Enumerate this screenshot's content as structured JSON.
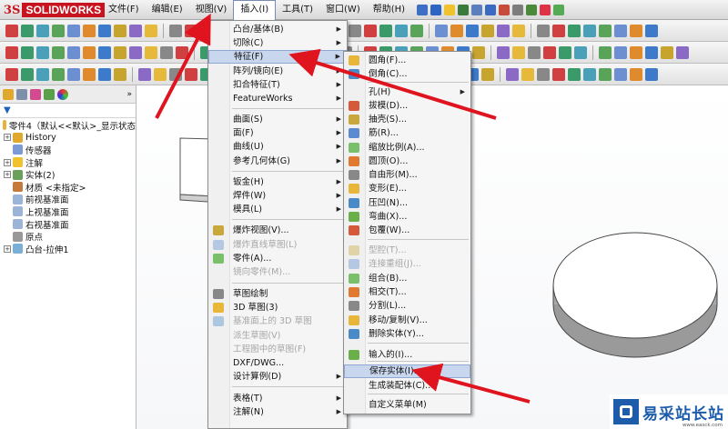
{
  "app": {
    "logo_ds": "3S",
    "logo_text": "SOLIDWORKS"
  },
  "menubar": [
    {
      "label": "文件(F)"
    },
    {
      "label": "编辑(E)"
    },
    {
      "label": "视图(V)"
    },
    {
      "label": "插入(I)",
      "active": true
    },
    {
      "label": "工具(T)"
    },
    {
      "label": "窗口(W)"
    },
    {
      "label": "帮助(H)"
    }
  ],
  "feature_tree": {
    "root": "零件4（默认<<默认>_显示状态",
    "items": [
      {
        "label": "History",
        "expandable": true
      },
      {
        "label": "传感器",
        "expandable": false
      },
      {
        "label": "注解",
        "expandable": true
      },
      {
        "label": "实体(2)",
        "expandable": true
      },
      {
        "label": "材质 <未指定>",
        "expandable": false
      },
      {
        "label": "前视基准面",
        "expandable": false
      },
      {
        "label": "上视基准面",
        "expandable": false
      },
      {
        "label": "右视基准面",
        "expandable": false
      },
      {
        "label": "原点",
        "expandable": false
      },
      {
        "label": "凸台-拉伸1",
        "expandable": true
      }
    ]
  },
  "insert_menu": [
    {
      "label": "凸台/基体(B)",
      "submenu": true
    },
    {
      "label": "切除(C)",
      "submenu": true
    },
    {
      "label": "特征(F)",
      "submenu": true,
      "highlighted": true
    },
    {
      "label": "阵列/镜向(E)",
      "submenu": true
    },
    {
      "label": "扣合特征(T)",
      "submenu": true
    },
    {
      "label": "FeatureWorks",
      "submenu": true
    },
    {
      "label": "曲面(S)",
      "submenu": true
    },
    {
      "label": "面(F)",
      "submenu": true
    },
    {
      "label": "曲线(U)",
      "submenu": true
    },
    {
      "label": "参考几何体(G)",
      "submenu": true
    },
    {
      "label": "钣金(H)",
      "submenu": true
    },
    {
      "label": "焊件(W)",
      "submenu": true
    },
    {
      "label": "模具(L)",
      "submenu": true
    },
    {
      "label": "爆炸视图(V)...",
      "icon": true
    },
    {
      "label": "爆炸直线草图(L)",
      "disabled": true,
      "icon": true
    },
    {
      "label": "零件(A)...",
      "icon": true
    },
    {
      "label": "镜向零件(M)...",
      "disabled": true
    },
    {
      "label": "草图绘制",
      "icon": true
    },
    {
      "label": "3D 草图(3)",
      "icon": true
    },
    {
      "label": "基准面上的 3D 草图",
      "disabled": true,
      "icon": true
    },
    {
      "label": "派生草图(V)",
      "disabled": true
    },
    {
      "label": "工程图中的草图(F)",
      "disabled": true
    },
    {
      "label": "DXF/DWG..."
    },
    {
      "label": "设计算例(D)",
      "submenu": true
    },
    {
      "label": "表格(T)",
      "submenu": true
    },
    {
      "label": "注解(N)",
      "submenu": true
    }
  ],
  "feature_submenu": [
    {
      "label": "圆角(F)...",
      "icon": true
    },
    {
      "label": "倒角(C)...",
      "icon": true
    },
    {
      "label": "孔(H)",
      "submenu": true
    },
    {
      "label": "拔模(D)...",
      "icon": true
    },
    {
      "label": "抽壳(S)...",
      "icon": true
    },
    {
      "label": "筋(R)...",
      "icon": true
    },
    {
      "label": "缩放比例(A)...",
      "icon": true
    },
    {
      "label": "圆顶(O)...",
      "icon": true
    },
    {
      "label": "自由形(M)...",
      "icon": true
    },
    {
      "label": "变形(E)...",
      "icon": true
    },
    {
      "label": "压凹(N)...",
      "icon": true
    },
    {
      "label": "弯曲(X)...",
      "icon": true
    },
    {
      "label": "包覆(W)...",
      "icon": true
    },
    {
      "label": "型腔(T)...",
      "disabled": true,
      "icon": true
    },
    {
      "label": "连接重组(J)...",
      "disabled": true,
      "icon": true
    },
    {
      "label": "组合(B)...",
      "icon": true
    },
    {
      "label": "相交(T)...",
      "icon": true
    },
    {
      "label": "分割(L)...",
      "icon": true
    },
    {
      "label": "移动/复制(V)...",
      "icon": true
    },
    {
      "label": "删除实体(Y)...",
      "icon": true
    },
    {
      "label": "输入的(I)...",
      "icon": true
    },
    {
      "label": "保存实体(I)...",
      "highlighted": true
    },
    {
      "label": "生成装配体(C)..."
    },
    {
      "label": "自定义菜单(M)"
    }
  ],
  "watermark": {
    "title": "易采站长站",
    "subtitle": "www.easck.com"
  },
  "colors": {
    "brand_red": "#c8141e",
    "highlight": "#c9d7ee",
    "arrow_red": "#e0141e"
  }
}
